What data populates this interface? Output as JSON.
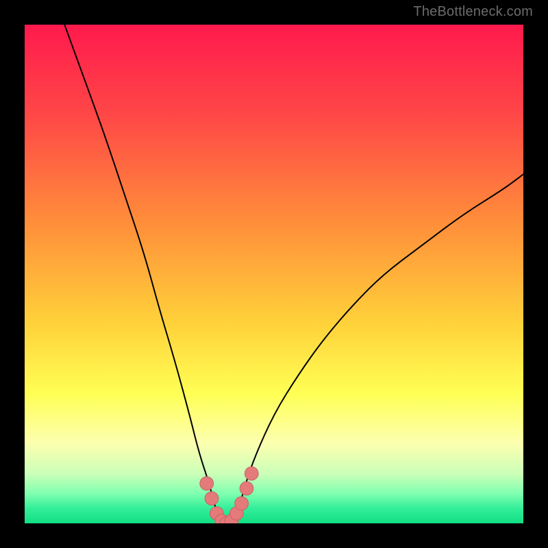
{
  "watermark": "TheBottleneck.com",
  "chart_data": {
    "type": "line",
    "title": "",
    "xlabel": "",
    "ylabel": "",
    "xlim": [
      0,
      100
    ],
    "ylim": [
      0,
      100
    ],
    "series": [
      {
        "name": "bottleneck-curve",
        "x": [
          8,
          12,
          16,
          20,
          24,
          27,
          30,
          33,
          35,
          37,
          38,
          39,
          40,
          41,
          42,
          43,
          44,
          46,
          50,
          55,
          60,
          66,
          72,
          80,
          88,
          96,
          100
        ],
        "y": [
          100,
          89,
          78,
          66,
          54,
          43,
          33,
          22,
          14,
          8,
          4,
          1,
          0,
          0,
          1,
          3,
          7,
          13,
          22,
          30,
          37,
          44,
          50,
          56,
          62,
          67,
          70
        ]
      }
    ],
    "threshold_band_y": 10,
    "markers": {
      "name": "highlight-points",
      "x": [
        36.5,
        37.5,
        38.5,
        39.5,
        40.5,
        41.5,
        42.5,
        43.5,
        44.5,
        45.5
      ],
      "y": [
        8,
        5,
        2,
        0.5,
        0,
        0.5,
        2,
        4,
        7,
        10
      ]
    },
    "background_gradient": {
      "stops": [
        {
          "offset": 0.0,
          "color": "#ff1a4d"
        },
        {
          "offset": 0.18,
          "color": "#ff4747"
        },
        {
          "offset": 0.4,
          "color": "#ff8f3a"
        },
        {
          "offset": 0.6,
          "color": "#ffd23a"
        },
        {
          "offset": 0.74,
          "color": "#ffff55"
        },
        {
          "offset": 0.84,
          "color": "#fcffb0"
        },
        {
          "offset": 0.9,
          "color": "#ccffb8"
        },
        {
          "offset": 0.94,
          "color": "#80ffb0"
        },
        {
          "offset": 0.97,
          "color": "#33ee99"
        },
        {
          "offset": 1.0,
          "color": "#12df84"
        }
      ]
    }
  }
}
